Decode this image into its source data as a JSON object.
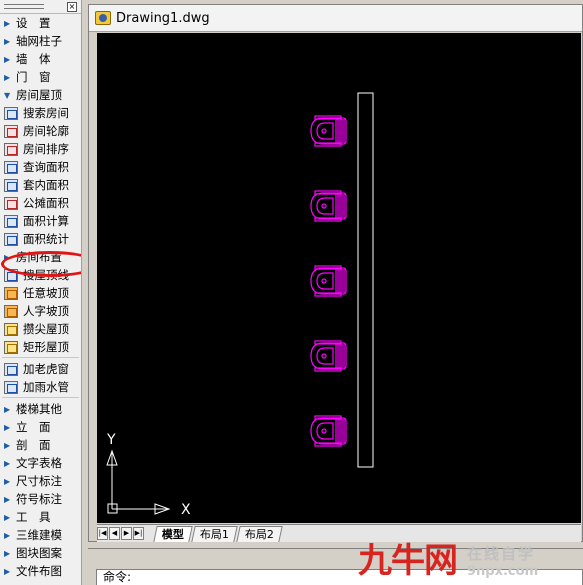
{
  "palette": {
    "items": [
      {
        "kind": "category",
        "label": "设　置",
        "expanded": false
      },
      {
        "kind": "category",
        "label": "轴网柱子",
        "expanded": false
      },
      {
        "kind": "category",
        "label": "墙　体",
        "expanded": false
      },
      {
        "kind": "category",
        "label": "门　窗",
        "expanded": false
      },
      {
        "kind": "category",
        "label": "房间屋顶",
        "expanded": true
      },
      {
        "kind": "command",
        "label": "搜索房间",
        "icon": "search-room-icon",
        "tone": "ic-blue"
      },
      {
        "kind": "command",
        "label": "房间轮廓",
        "icon": "room-outline-icon",
        "tone": "ic-red"
      },
      {
        "kind": "command",
        "label": "房间排序",
        "icon": "room-sort-icon",
        "tone": "ic-red"
      },
      {
        "kind": "command",
        "label": "查询面积",
        "icon": "query-area-icon",
        "tone": "ic-blue"
      },
      {
        "kind": "command",
        "label": "套内面积",
        "icon": "inner-area-icon",
        "tone": "ic-blue"
      },
      {
        "kind": "command",
        "label": "公摊面积",
        "icon": "shared-area-icon",
        "tone": "ic-red"
      },
      {
        "kind": "command",
        "label": "面积计算",
        "icon": "area-calc-icon",
        "tone": "ic-blue"
      },
      {
        "kind": "command",
        "label": "面积统计",
        "icon": "area-stats-icon",
        "tone": "ic-blue"
      },
      {
        "kind": "category",
        "label": "房间布置",
        "expanded": false,
        "highlighted": true
      },
      {
        "kind": "command",
        "label": "搜屋顶线",
        "icon": "roof-line-icon",
        "tone": "ic-blue"
      },
      {
        "kind": "command",
        "label": "任意坡顶",
        "icon": "any-slope-roof-icon",
        "tone": "ic-orange"
      },
      {
        "kind": "command",
        "label": "人字坡顶",
        "icon": "gable-roof-icon",
        "tone": "ic-orange"
      },
      {
        "kind": "command",
        "label": "攒尖屋顶",
        "icon": "pyramid-roof-icon",
        "tone": "ic-yellow"
      },
      {
        "kind": "command",
        "label": "矩形屋顶",
        "icon": "rect-roof-icon",
        "tone": "ic-yellow"
      },
      {
        "kind": "separator"
      },
      {
        "kind": "command",
        "label": "加老虎窗",
        "icon": "dormer-window-icon",
        "tone": "ic-blue"
      },
      {
        "kind": "command",
        "label": "加雨水管",
        "icon": "rain-pipe-icon",
        "tone": "ic-blue"
      },
      {
        "kind": "separator"
      },
      {
        "kind": "category",
        "label": "楼梯其他",
        "expanded": false
      },
      {
        "kind": "category",
        "label": "立　面",
        "expanded": false
      },
      {
        "kind": "category",
        "label": "剖　面",
        "expanded": false
      },
      {
        "kind": "category",
        "label": "文字表格",
        "expanded": false
      },
      {
        "kind": "category",
        "label": "尺寸标注",
        "expanded": false
      },
      {
        "kind": "category",
        "label": "符号标注",
        "expanded": false
      },
      {
        "kind": "category",
        "label": "工　具",
        "expanded": false
      },
      {
        "kind": "category",
        "label": "三维建模",
        "expanded": false
      },
      {
        "kind": "category",
        "label": "图块图案",
        "expanded": false
      },
      {
        "kind": "category",
        "label": "文件布图",
        "expanded": false
      }
    ]
  },
  "document": {
    "title": "Drawing1.dwg",
    "icon": "dwg-file-icon"
  },
  "canvas": {
    "background": "#000000",
    "entity_color": "#ff00ff",
    "line_color": "#ffffff",
    "ucs_x_label": "X",
    "ucs_y_label": "Y",
    "fixture_count": 5
  },
  "layout_tabs": {
    "nav_icons": [
      "first-tab-icon",
      "prev-tab-icon",
      "next-tab-icon",
      "last-tab-icon"
    ],
    "tabs": [
      {
        "label": "模型",
        "active": true
      },
      {
        "label": "布局1",
        "active": false
      },
      {
        "label": "布局2",
        "active": false
      }
    ]
  },
  "command_line": {
    "prompt": "命令:"
  },
  "watermark": {
    "brand": "九牛网",
    "tagline": "在线自学",
    "url": "9npx.com"
  },
  "colors": {
    "highlight_ring": "#e01414",
    "watermark_red": "#d8241f"
  }
}
